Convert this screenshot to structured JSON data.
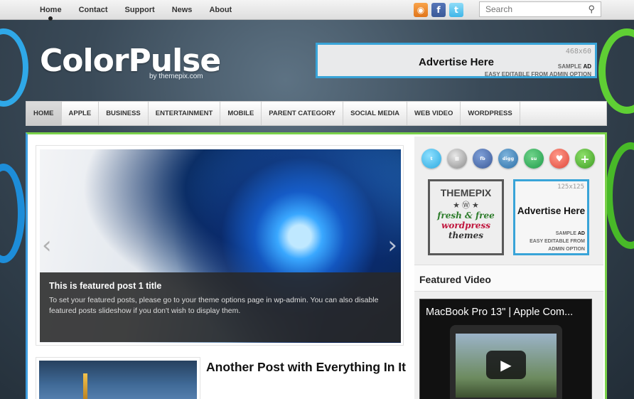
{
  "topnav": [
    "Home",
    "Contact",
    "Support",
    "News",
    "About"
  ],
  "search": {
    "placeholder": "Search"
  },
  "header": {
    "logo": "ColorPulse",
    "logo_sub": "by themepix.com"
  },
  "ad_banner": {
    "size": "468x60",
    "title": "Advertise Here",
    "sample": "SAMPLE",
    "ad": "AD",
    "subtitle": "EASY EDITABLE FROM ADMIN OPTION"
  },
  "mainnav": [
    "HOME",
    "APPLE",
    "BUSINESS",
    "ENTERTAINMENT",
    "MOBILE",
    "PARENT CATEGORY",
    "SOCIAL MEDIA",
    "WEB VIDEO",
    "WORDPRESS"
  ],
  "slider": {
    "title": "This is featured post 1 title",
    "text": "To set your featured posts, please go to your theme options page in wp-admin. You can also disable featured posts slideshow if you don't wish to display them."
  },
  "post": {
    "title": "Another Post with Everything In It"
  },
  "sidebar": {
    "themepix": {
      "name": "THEMEPIX",
      "line1": "fresh & free",
      "line2": "wordpress",
      "line3": "themes"
    },
    "ad125": {
      "size": "125x125",
      "title": "Advertise Here",
      "sample": "SAMPLE",
      "ad": "AD",
      "line2": "EASY EDITABLE FROM",
      "line3": "ADMIN OPTION"
    },
    "featured_video_heading": "Featured Video",
    "video_title": "MacBook Pro 13\" | Apple Com..."
  },
  "social_icons": [
    "twitter",
    "delicious",
    "facebook",
    "digg",
    "stumbleupon",
    "heart",
    "plus"
  ],
  "colors": {
    "accent_blue": "#39a4d8",
    "accent_green": "#7ad14a"
  }
}
